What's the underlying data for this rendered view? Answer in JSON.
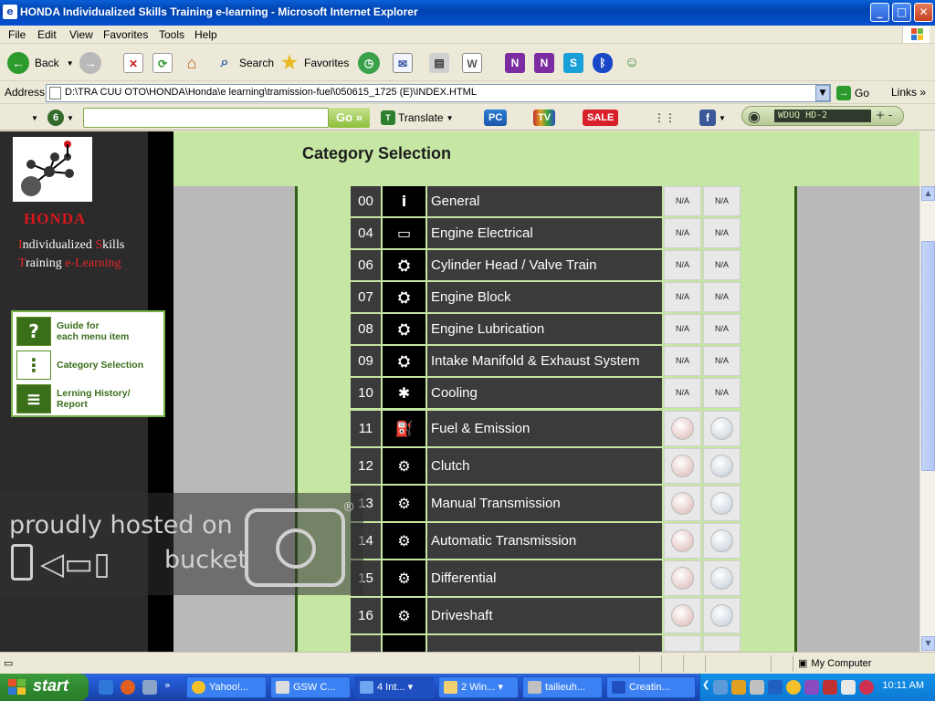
{
  "window": {
    "title": "HONDA Individualized Skills Training e-learning - Microsoft Internet Explorer",
    "controls": {
      "minimize": "_",
      "maximize": "□",
      "close": "✕"
    }
  },
  "menu": [
    "File",
    "Edit",
    "View",
    "Favorites",
    "Tools",
    "Help"
  ],
  "toolbar": {
    "back": "Back",
    "search": "Search",
    "favorites": "Favorites"
  },
  "address": {
    "label": "Address",
    "value": "D:\\TRA CUU OTO\\HONDA\\Honda\\e learning\\tramission-fuel\\050615_1725 (E)\\INDEX.HTML",
    "go": "Go",
    "links": "Links"
  },
  "custom_toolbar": {
    "go": "Go",
    "translate": "Translate",
    "pc": "PC",
    "tv": "TV",
    "sale": "SALE",
    "radio": "WDUQ HD-2"
  },
  "sidebar": {
    "brand": "HONDA",
    "tagline_line1": [
      "I",
      "ndividualized ",
      "S",
      "kills"
    ],
    "tagline_line2": [
      "T",
      "raining ",
      "e-L",
      "earning"
    ],
    "menu": [
      {
        "icon": "?",
        "label_line1": "Guide for",
        "label_line2": "each menu item"
      },
      {
        "icon": "⋮",
        "label_line1": "Category Selection",
        "label_line2": ""
      },
      {
        "icon": "≡",
        "label_line1": "Lerning History/",
        "label_line2": "Report"
      }
    ]
  },
  "page": {
    "title": "Category Selection"
  },
  "categories": [
    {
      "num": "00",
      "name": "General",
      "icon": "i",
      "status": "na",
      "s1": "N/A",
      "s2": "N/A"
    },
    {
      "num": "04",
      "name": "Engine Electrical",
      "icon": "ENGINE",
      "status": "na",
      "s1": "N/A",
      "s2": "N/A"
    },
    {
      "num": "06",
      "name": "Cylinder Head / Valve Train",
      "icon": "engine",
      "status": "na",
      "s1": "N/A",
      "s2": "N/A"
    },
    {
      "num": "07",
      "name": "Engine Block",
      "icon": "engine",
      "status": "na",
      "s1": "N/A",
      "s2": "N/A"
    },
    {
      "num": "08",
      "name": "Engine Lubrication",
      "icon": "engine",
      "status": "na",
      "s1": "N/A",
      "s2": "N/A"
    },
    {
      "num": "09",
      "name": "Intake Manifold & Exhaust System",
      "icon": "engine",
      "status": "na",
      "s1": "N/A",
      "s2": "N/A"
    },
    {
      "num": "10",
      "name": "Cooling",
      "icon": "fan",
      "status": "na",
      "s1": "N/A",
      "s2": "N/A"
    },
    {
      "num": "11",
      "name": "Fuel & Emission",
      "icon": "fuel",
      "status": "dots"
    },
    {
      "num": "12",
      "name": "Clutch",
      "icon": "gears",
      "status": "dots"
    },
    {
      "num": "13",
      "name": "Manual Transmission",
      "icon": "gears",
      "status": "dots"
    },
    {
      "num": "14",
      "name": "Automatic Transmission",
      "icon": "gears",
      "status": "dots"
    },
    {
      "num": "15",
      "name": "Differential",
      "icon": "gears",
      "status": "dots"
    },
    {
      "num": "16",
      "name": "Driveshaft",
      "icon": "gears",
      "status": "dots"
    }
  ],
  "watermark": {
    "line1": "proudly hosted on",
    "line2": "bucket",
    "mark": "®"
  },
  "status": {
    "zone": "My Computer"
  },
  "taskbar": {
    "start": "start",
    "tasks": [
      "Yahoo!...",
      "GSW C...",
      "4 Int...",
      "2 Win...",
      "tailieuh...",
      "Creatin..."
    ],
    "clock": "10:11 AM"
  },
  "colors": {
    "header_bg": "#c6e6a4",
    "frame_border": "#2f5e16",
    "honda_red": "#d8161c",
    "sidebar_bg": "#2b2b2b"
  }
}
